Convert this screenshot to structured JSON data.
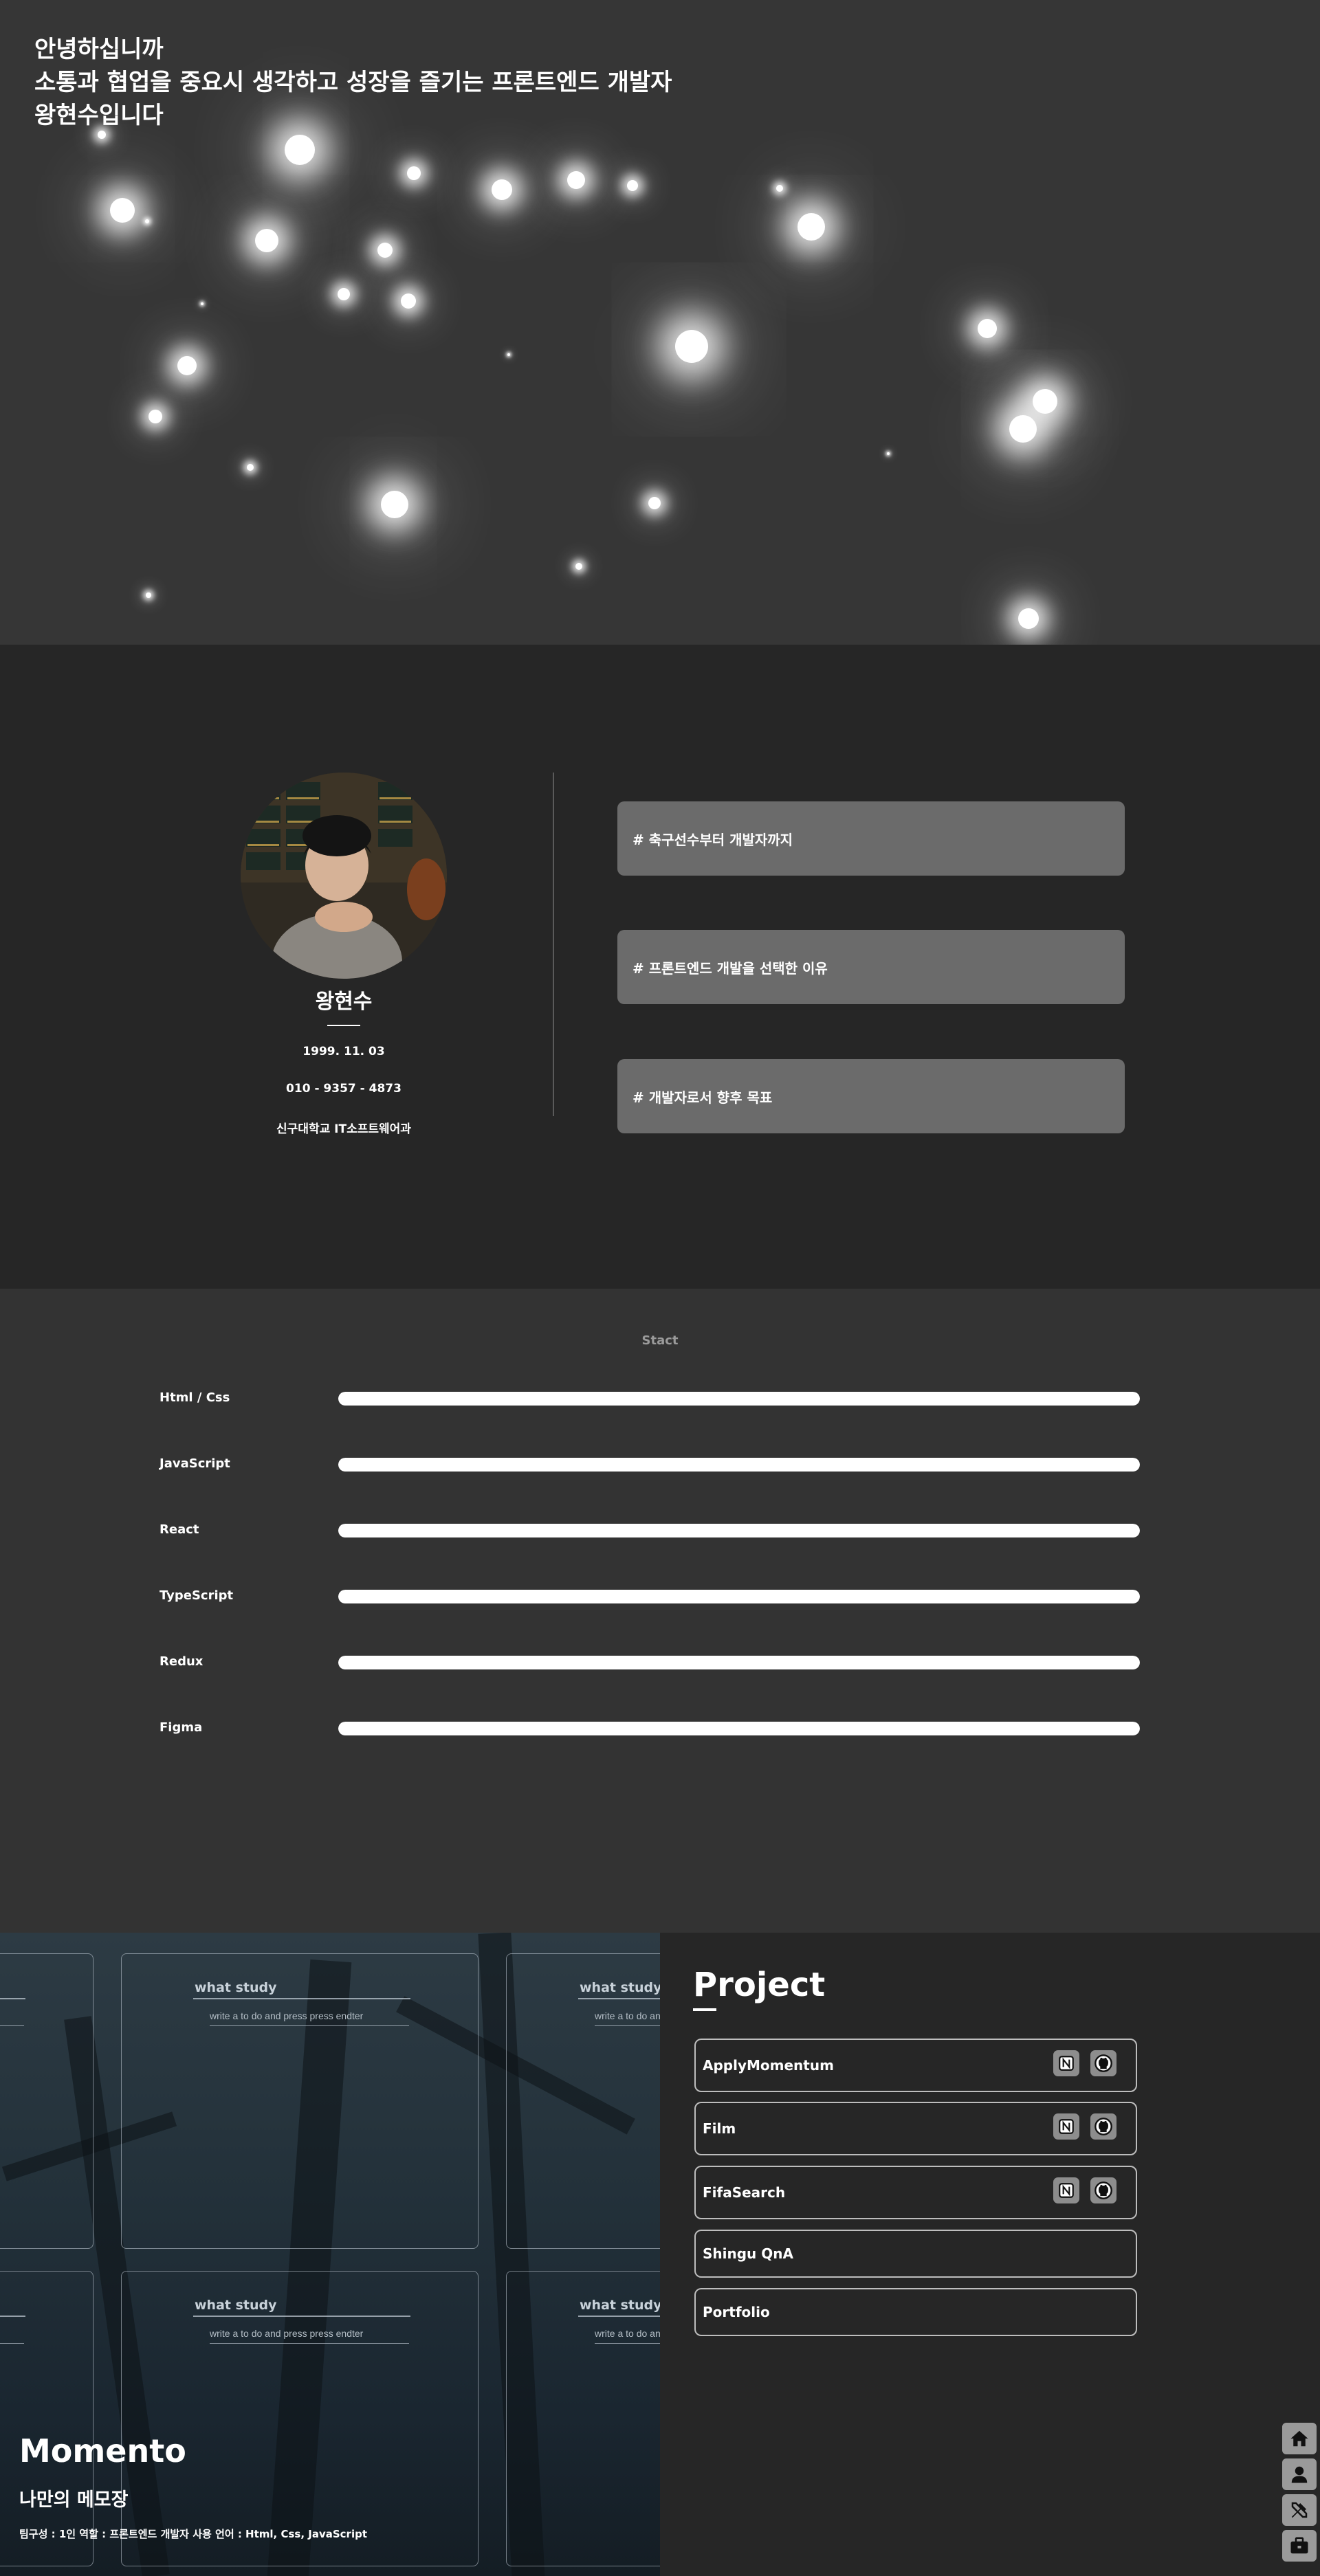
{
  "hero": {
    "lines": [
      "안녕하십니까",
      "소통과 협업을 중요시 생각하고 성장을 즐기는 프론트엔드 개발자",
      "왕현수입니다"
    ]
  },
  "about": {
    "name": "왕현수",
    "birth": "1999. 11. 03",
    "phone": "010 - 9357 - 4873",
    "school": "신구대학교 IT소프트웨어과",
    "cards": [
      "# 축구선수부터 개발자까지",
      "# 프론트엔드 개발을 선택한 이유",
      "# 개발자로서 향후 목표"
    ]
  },
  "stack": {
    "title": "Stact",
    "skills": [
      {
        "label": "Html / Css",
        "level": 1.0
      },
      {
        "label": "JavaScript",
        "level": 1.0
      },
      {
        "label": "React",
        "level": 1.0
      },
      {
        "label": "TypeScript",
        "level": 1.0
      },
      {
        "label": "Redux",
        "level": 1.0
      },
      {
        "label": "Figma",
        "level": 1.0
      }
    ]
  },
  "preview": {
    "card_title": "what study",
    "card_placeholder": "write a to do and press press endter",
    "title": "Momento",
    "subtitle": "나만의 메모장",
    "meta": "팀구성 : 1인     역할 : 프론트엔드 개발자     사용 언어 : Html, Css, JavaScript"
  },
  "project": {
    "heading": "Project",
    "items": [
      {
        "name": "ApplyMomentum",
        "icons": [
          "notion-icon",
          "github-icon"
        ]
      },
      {
        "name": "Film",
        "icons": [
          "notion-icon",
          "github-icon"
        ]
      },
      {
        "name": "FifaSearch",
        "icons": [
          "notion-icon",
          "github-icon"
        ]
      },
      {
        "name": "Shingu QnA",
        "icons": []
      },
      {
        "name": "Portfolio",
        "icons": []
      }
    ]
  },
  "side_nav": [
    "home-icon",
    "user-icon",
    "tools-icon",
    "briefcase-icon"
  ],
  "colors": {
    "hero_bg": "#363636",
    "about_bg": "#262626",
    "card_bg": "#6b6b6b",
    "stack_bg": "#333333",
    "accent": "#ffffff"
  }
}
